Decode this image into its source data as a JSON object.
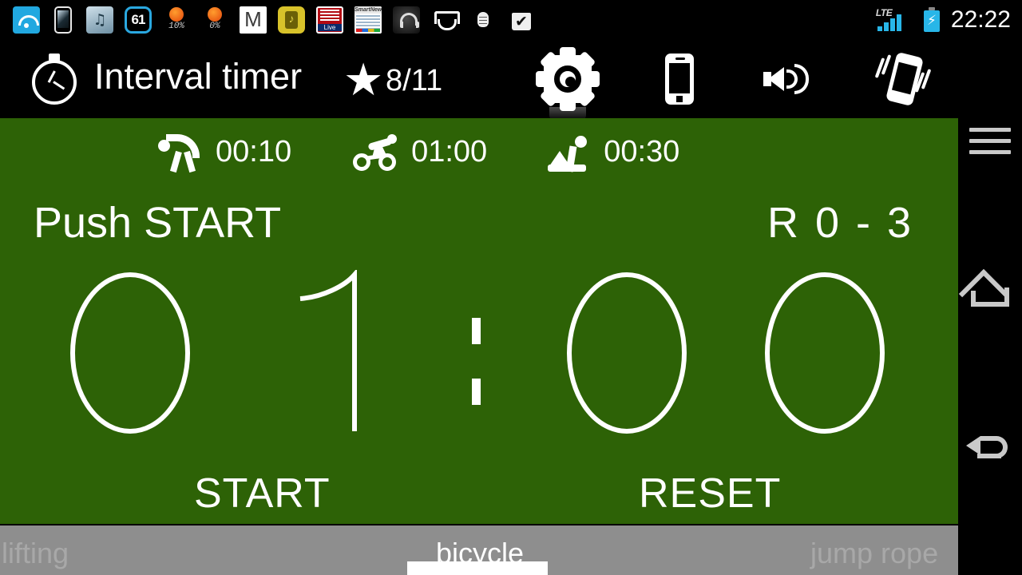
{
  "statusbar": {
    "time": "22:22",
    "network_type": "LTE",
    "signal_bars": 4,
    "battery_state": "charging",
    "icons": [
      {
        "name": "wifi-icon",
        "label": "wifi"
      },
      {
        "name": "phone-mirror-icon",
        "label": "phone"
      },
      {
        "name": "music-app-icon",
        "label": "music"
      },
      {
        "name": "battery-percent-icon",
        "label": "61"
      },
      {
        "name": "weather-sun-icon",
        "label": "10%"
      },
      {
        "name": "weather-sun-icon-2",
        "label": "0%"
      },
      {
        "name": "gmail-icon",
        "label": "M"
      },
      {
        "name": "health-app-icon",
        "label": "health"
      },
      {
        "name": "ntv-news-icon",
        "label": "Live"
      },
      {
        "name": "smartnews-icon",
        "label": "SmartNews"
      },
      {
        "name": "headphone-icon",
        "label": "audio"
      },
      {
        "name": "cart-icon",
        "label": "cart"
      },
      {
        "name": "bug-icon",
        "label": "debug"
      },
      {
        "name": "store-check-icon",
        "label": "store"
      }
    ]
  },
  "appbar": {
    "title": "Interval timer",
    "favorite_count": "8/11",
    "actions": [
      {
        "name": "settings-button",
        "label": "settings"
      },
      {
        "name": "screen-button",
        "label": "screen"
      },
      {
        "name": "sound-button",
        "label": "sound"
      },
      {
        "name": "vibration-button",
        "label": "vibration"
      }
    ]
  },
  "workout": {
    "phases": [
      {
        "icon": "stretch-icon",
        "label": "stretch",
        "time": "00:10"
      },
      {
        "icon": "bicycle-icon",
        "label": "bicycle",
        "time": "01:00"
      },
      {
        "icon": "situp-icon",
        "label": "sit-up",
        "time": "00:30"
      }
    ],
    "status_text": "Push START",
    "round_label": "R 0 - 3",
    "timer": {
      "display": "01:00",
      "digits": [
        "0",
        "1",
        "0",
        "0"
      ],
      "separator": ":"
    },
    "start_label": "START",
    "reset_label": "RESET"
  },
  "tabs": [
    {
      "label": "lifting",
      "active": false
    },
    {
      "label": "bicycle",
      "active": true
    },
    {
      "label": "jump rope",
      "active": false
    }
  ],
  "navbar": [
    {
      "name": "menu-button",
      "label": "menu"
    },
    {
      "name": "home-button",
      "label": "home"
    },
    {
      "name": "back-button",
      "label": "back"
    }
  ],
  "colors": {
    "app_background": "#2d6206",
    "chrome": "#000000",
    "tabbar": "#8e8e8e",
    "accent": "#28b6e8",
    "foreground": "#ffffff"
  }
}
